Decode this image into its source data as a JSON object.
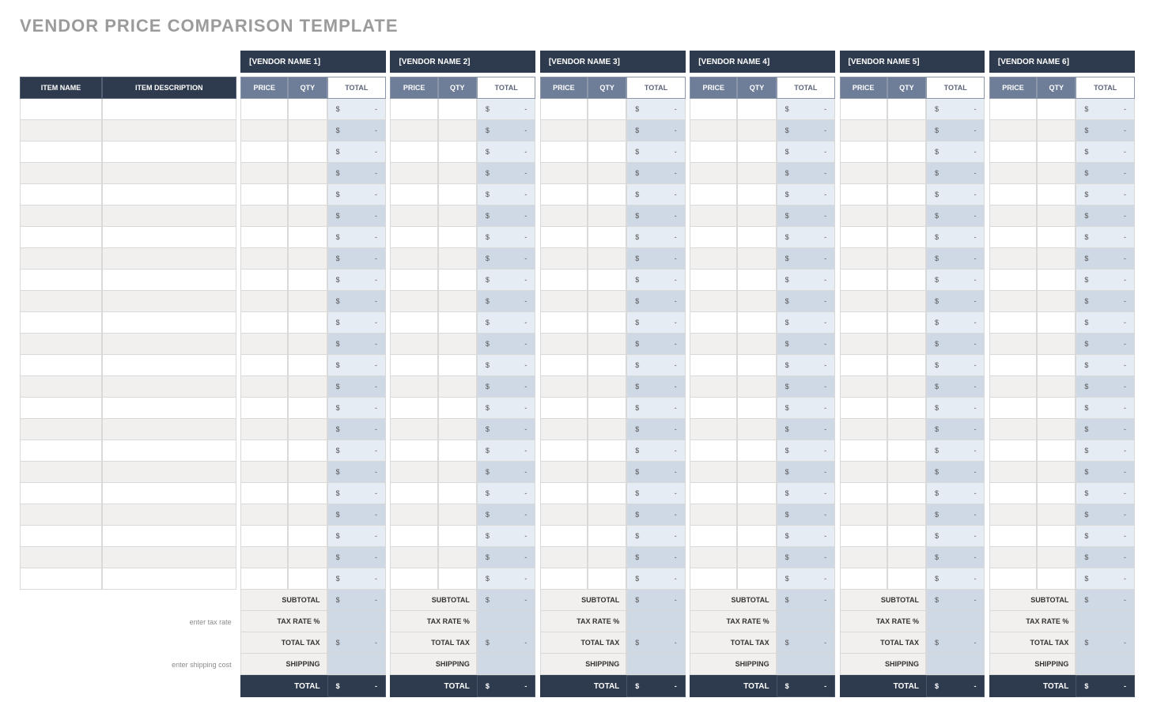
{
  "title": "VENDOR PRICE COMPARISON TEMPLATE",
  "headers": {
    "item_name": "ITEM NAME",
    "item_desc": "ITEM DESCRIPTION",
    "price": "PRICE",
    "qty": "QTY",
    "total": "TOTAL"
  },
  "vendors": [
    {
      "name": "[VENDOR NAME 1]"
    },
    {
      "name": "[VENDOR NAME 2]"
    },
    {
      "name": "[VENDOR NAME 3]"
    },
    {
      "name": "[VENDOR NAME 4]"
    },
    {
      "name": "[VENDOR NAME 5]"
    },
    {
      "name": "[VENDOR NAME 6]"
    }
  ],
  "row_count": 23,
  "money": {
    "symbol": "$",
    "empty": "-"
  },
  "summary": {
    "subtotal": "SUBTOTAL",
    "tax_rate": "TAX RATE %",
    "total_tax": "TOTAL TAX",
    "shipping": "SHIPPING",
    "total": "TOTAL"
  },
  "hints": {
    "tax": "enter tax rate",
    "shipping": "enter shipping cost"
  }
}
